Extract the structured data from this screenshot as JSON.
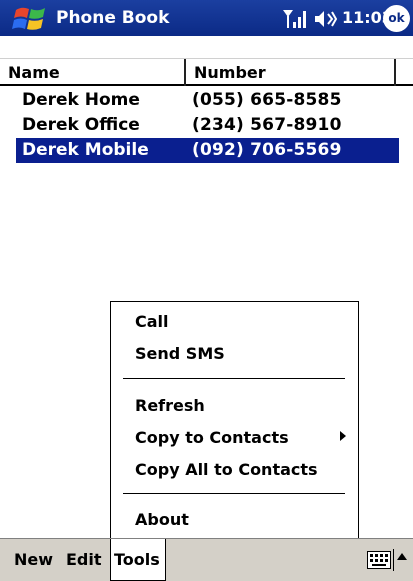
{
  "titlebar": {
    "app_title": "Phone Book",
    "time": "11:03",
    "ok_label": "ok",
    "icons": [
      "windows-start-icon",
      "signal-icon",
      "volume-icon"
    ],
    "background": "#0b2a86"
  },
  "list": {
    "columns": [
      "Name",
      "Number"
    ],
    "rows": [
      {
        "name": "Derek Home",
        "number": "(055) 665-8585",
        "selected": false
      },
      {
        "name": "Derek Office",
        "number": "(234) 567-8910",
        "selected": false
      },
      {
        "name": "Derek Mobile",
        "number": "(092) 706-5569",
        "selected": true
      }
    ],
    "selection_color": "#0a1f8f"
  },
  "menu": {
    "items": [
      "Call",
      "Send SMS",
      "Refresh",
      "Copy to Contacts",
      "Copy All to Contacts",
      "About"
    ],
    "submenu_item": "Copy to Contacts"
  },
  "bottombar": {
    "items": [
      "New",
      "Edit",
      "Tools"
    ],
    "active": "Tools",
    "icons": [
      "keyboard-icon",
      "input-panel-arrow-icon"
    ]
  }
}
